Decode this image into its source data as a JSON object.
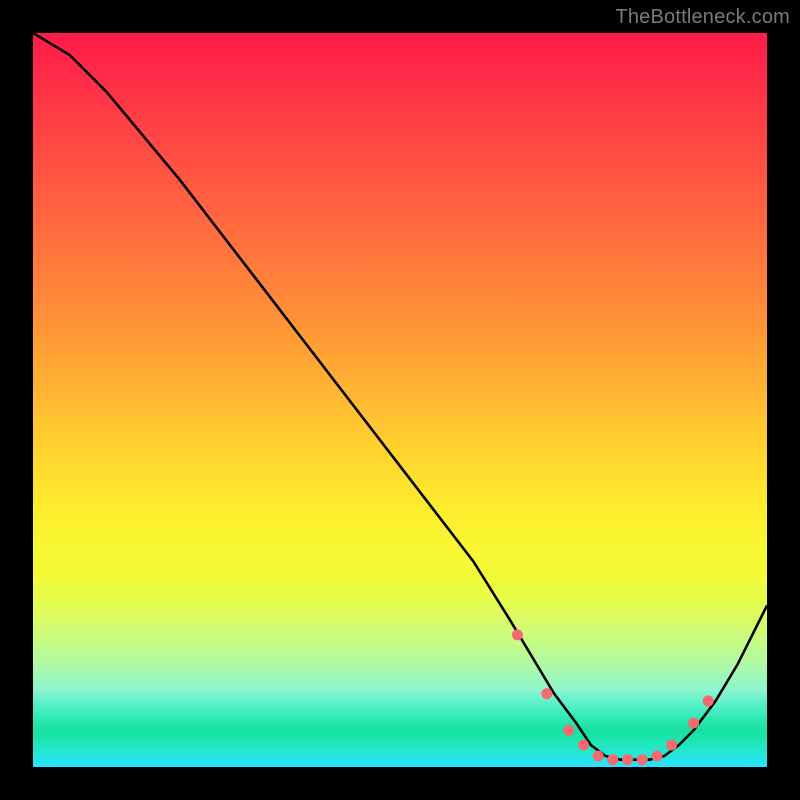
{
  "attribution": "TheBottleneck.com",
  "chart_data": {
    "type": "line",
    "title": "",
    "xlabel": "",
    "ylabel": "",
    "xlim": [
      0,
      100
    ],
    "ylim": [
      0,
      100
    ],
    "x": [
      0,
      5,
      10,
      20,
      30,
      40,
      50,
      60,
      65,
      68,
      71,
      74,
      76,
      78,
      80,
      82,
      84,
      86,
      88,
      90,
      93,
      96,
      100
    ],
    "values": [
      100,
      97,
      92,
      80,
      67,
      54,
      41,
      28,
      20,
      15,
      10,
      6,
      3,
      1.5,
      1,
      1,
      1,
      1.5,
      3,
      5,
      9,
      14,
      22
    ],
    "markers_x": [
      66,
      70,
      73,
      75,
      77,
      79,
      81,
      83,
      85,
      87,
      90,
      92
    ],
    "markers_y": [
      18,
      10,
      5,
      3,
      1.5,
      1,
      1,
      1,
      1.5,
      3,
      6,
      9
    ],
    "marker_color": "#f46a6e",
    "line_color": "#000000",
    "annotations": []
  }
}
